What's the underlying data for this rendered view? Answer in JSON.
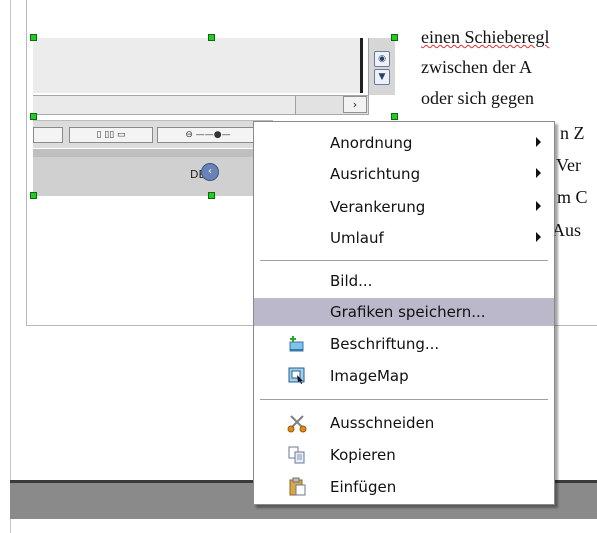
{
  "document_text": {
    "lines": [
      "einen Schieberegl",
      "zwischen der A",
      "oder sich gegen",
      "n Z",
      "Ver",
      "m C",
      "Aus"
    ]
  },
  "embedded_image": {
    "language_label": "DE"
  },
  "context_menu": {
    "items": [
      {
        "label": "Anordnung",
        "submenu": true
      },
      {
        "label": "Ausrichtung",
        "submenu": true
      },
      {
        "label": "Verankerung",
        "submenu": true
      },
      {
        "label": "Umlauf",
        "submenu": true
      },
      {
        "label": "Bild..."
      },
      {
        "label": "Grafiken speichern...",
        "highlighted": true
      },
      {
        "label": "Beschriftung...",
        "icon": "caption-icon"
      },
      {
        "label": "ImageMap",
        "icon": "imagemap-icon"
      },
      {
        "label": "Ausschneiden",
        "icon": "scissors-icon"
      },
      {
        "label": "Kopieren",
        "icon": "copy-icon"
      },
      {
        "label": "Einfügen",
        "icon": "paste-icon"
      }
    ],
    "highlight_color": "#bcb8cc"
  },
  "colors": {
    "handle": "#22cc22",
    "spellcheck": "#e03030"
  }
}
